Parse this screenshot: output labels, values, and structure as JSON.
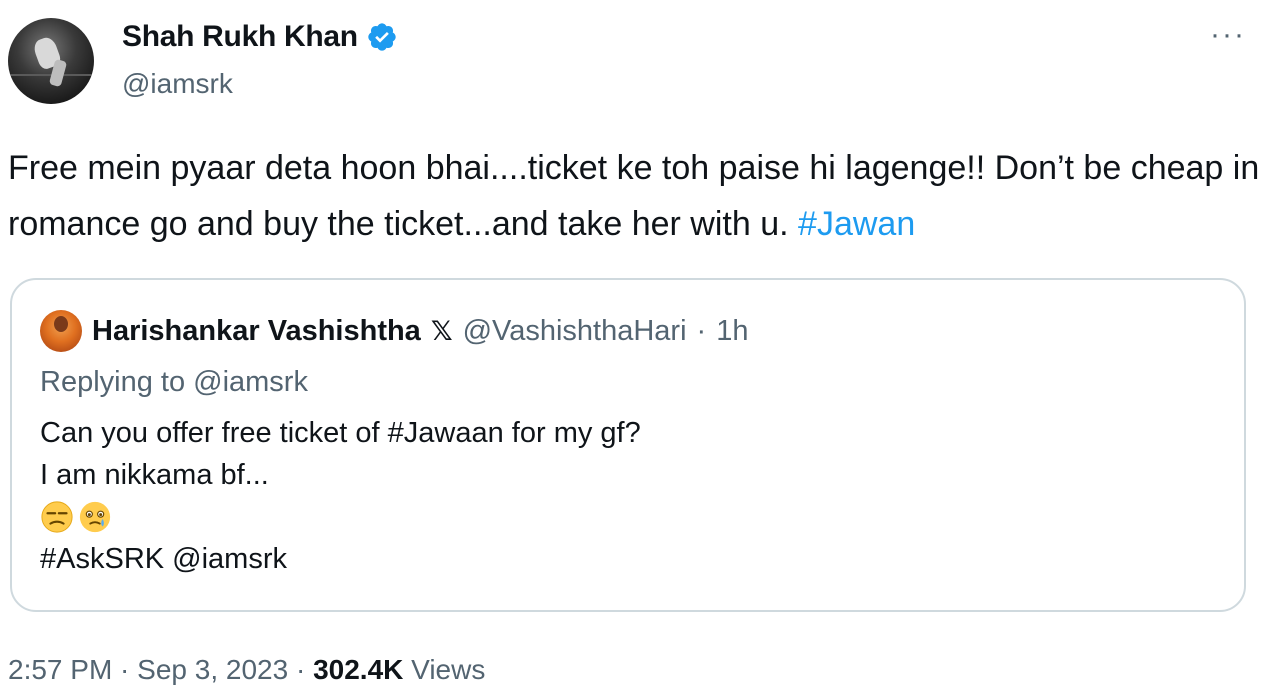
{
  "author": {
    "display_name": "Shah Rukh Khan",
    "handle": "@iamsrk",
    "verified": true
  },
  "more_menu": "···",
  "tweet": {
    "text_before_hashtag": "Free mein pyaar deta hoon bhai....ticket ke toh paise hi lagenge!! Don’t be cheap in romance go and buy the ticket...and take her with u. ",
    "hashtag": "#Jawan"
  },
  "quoted_tweet": {
    "display_name": "Harishankar Vashishtha",
    "x_badge": "𝕏",
    "handle": "@VashishthaHari",
    "separator": "·",
    "time_ago": "1h",
    "replying_to": "Replying to @iamsrk",
    "line1": "Can you offer free ticket of #Jawaan for my gf?",
    "line2": "I am nikkama bf...",
    "emojis": [
      "unamused-face-icon",
      "face-holding-back-tears-icon"
    ],
    "line4": "#AskSRK @iamsrk"
  },
  "meta": {
    "time": "2:57 PM",
    "separator1": " · ",
    "date": "Sep 3, 2023",
    "separator2": " · ",
    "views": "302.4K",
    "views_label": " Views"
  },
  "colors": {
    "link": "#1d9bf0",
    "secondary_text": "#536471",
    "primary_text": "#0f1419",
    "border": "#cfd9de",
    "verified_badge": "#1d9bf0"
  }
}
